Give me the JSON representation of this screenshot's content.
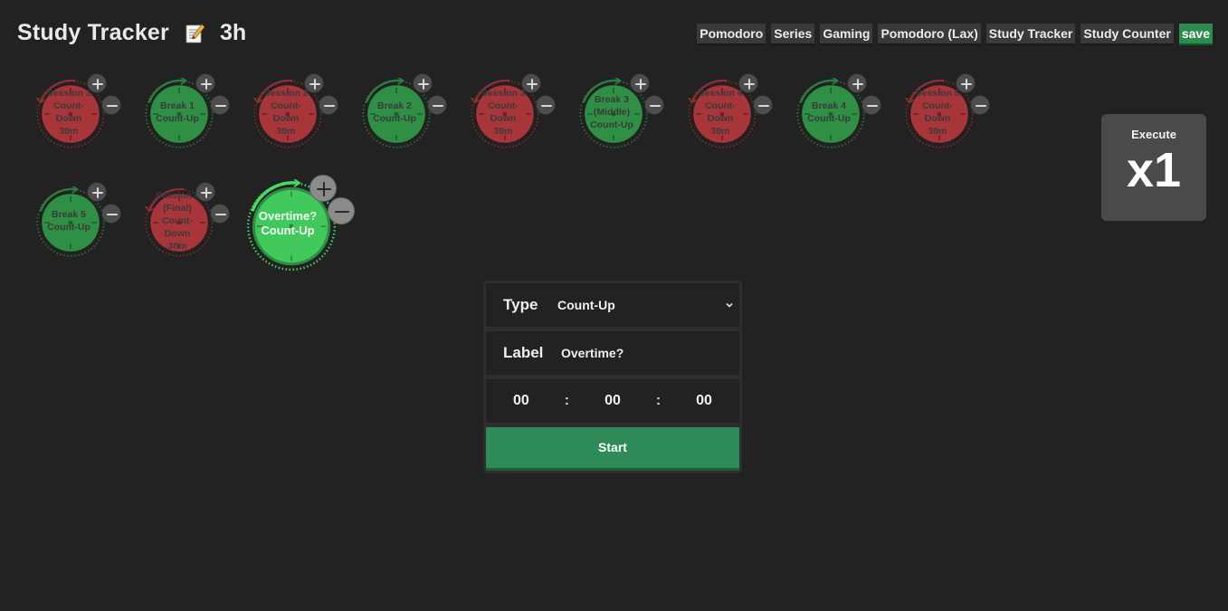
{
  "header": {
    "title": "Study Tracker",
    "total_duration": "3h",
    "title_icon": "memo-icon"
  },
  "presets": [
    "Pomodoro",
    "Series",
    "Gaming",
    "Pomodoro (Lax)",
    "Study Tracker",
    "Study Counter",
    "save"
  ],
  "execute": {
    "label": "Execute",
    "multiplier": "x1"
  },
  "timers": [
    {
      "name": "session-1",
      "lines": [
        "Session 1",
        "Count-Down",
        "30m"
      ],
      "kind": "countdown"
    },
    {
      "name": "break-1",
      "lines": [
        "Break 1",
        "Count-Up"
      ],
      "kind": "countup"
    },
    {
      "name": "session-2",
      "lines": [
        "Session 2",
        "Count-Down",
        "30m"
      ],
      "kind": "countdown"
    },
    {
      "name": "break-2",
      "lines": [
        "Break 2",
        "Count-Up"
      ],
      "kind": "countup"
    },
    {
      "name": "session-3",
      "lines": [
        "Session 3",
        "Count-Down",
        "30m"
      ],
      "kind": "countdown"
    },
    {
      "name": "break-3",
      "lines": [
        "Break 3",
        "(Middle)",
        "Count-Up"
      ],
      "kind": "countup"
    },
    {
      "name": "session-4",
      "lines": [
        "Session 4",
        "Count-Down",
        "30m"
      ],
      "kind": "countdown"
    },
    {
      "name": "break-4",
      "lines": [
        "Break 4",
        "Count-Up"
      ],
      "kind": "countup"
    },
    {
      "name": "session-5",
      "lines": [
        "Session 5",
        "Count-Down",
        "30m"
      ],
      "kind": "countdown"
    },
    {
      "name": "break-5",
      "lines": [
        "Break 5",
        "Count-Up"
      ],
      "kind": "countup"
    },
    {
      "name": "session-6",
      "lines": [
        "Session 6",
        "(Final)",
        "Count-Down",
        "30m"
      ],
      "kind": "countdown"
    },
    {
      "name": "overtime",
      "lines": [
        "Overtime?",
        "Count-Up"
      ],
      "kind": "countup",
      "selected": true
    }
  ],
  "editor": {
    "type_label": "Type",
    "type_value": "Count-Up",
    "label_label": "Label",
    "label_value": "Overtime?",
    "hours": "00",
    "minutes": "00",
    "seconds": "00",
    "separator": ":",
    "start_label": "Start"
  },
  "colors": {
    "countdown_fill": "#a8353a",
    "countdown_ring": "#8a2e33",
    "countup_fill": "#2f8f45",
    "countup_ring": "#2c7d3e",
    "selected_fill": "#42c95c",
    "accent_green": "#2e8b57"
  }
}
